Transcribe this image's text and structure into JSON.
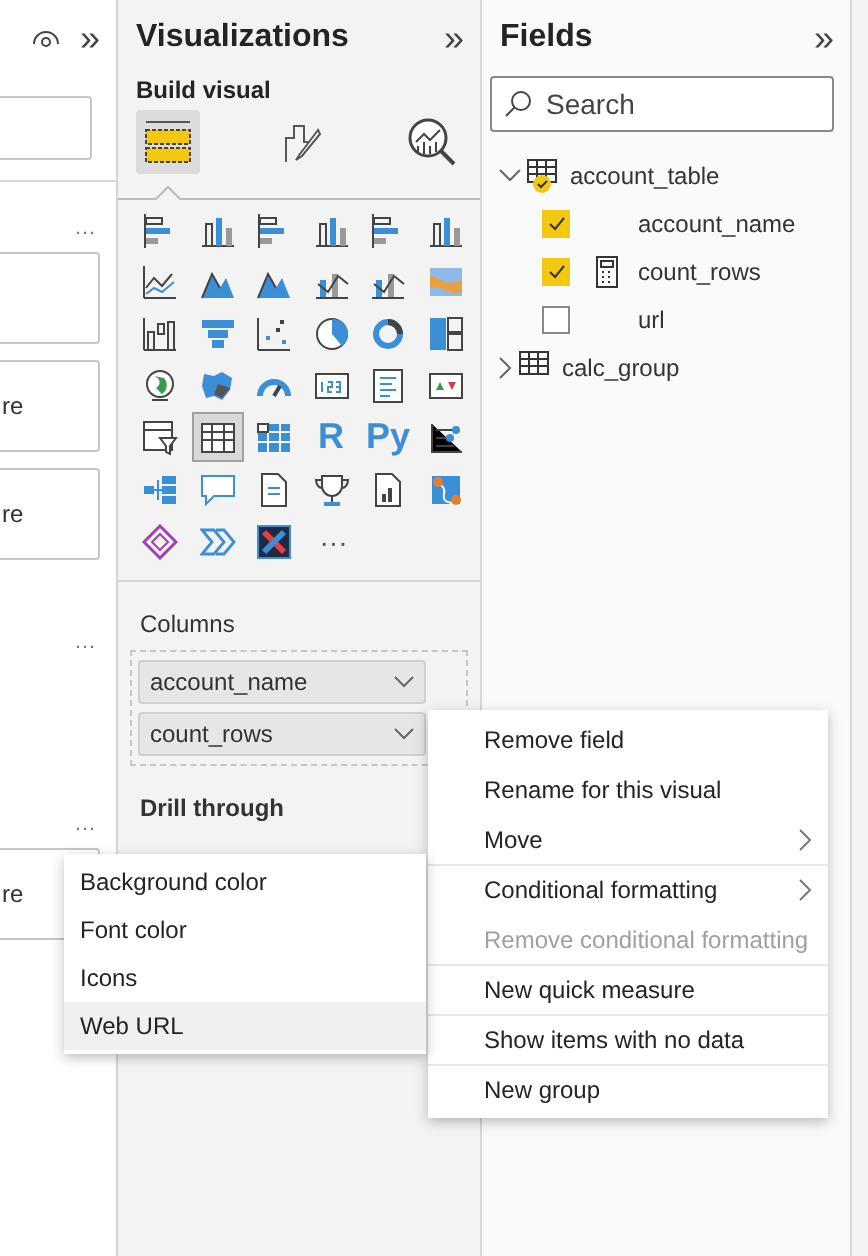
{
  "filters_pane": {
    "collapse": "»",
    "boxes": [
      {
        "kind": "field"
      },
      {
        "kind": "card"
      },
      {
        "kind": "card",
        "text": "re"
      },
      {
        "kind": "card",
        "text": "re"
      },
      {
        "kind": "card",
        "text": "re"
      }
    ],
    "more": [
      "…",
      "…",
      "…"
    ]
  },
  "visualizations": {
    "title": "Visualizations",
    "collapse": "»",
    "subtitle": "Build visual",
    "modes": [
      {
        "selected": true
      },
      {
        "selected": false
      },
      {
        "selected": false
      }
    ],
    "gallery": [
      {
        "selected": false
      },
      {
        "selected": false
      },
      {
        "selected": false
      },
      {
        "selected": false
      },
      {
        "selected": false
      },
      {
        "selected": false
      },
      {
        "selected": false
      },
      {
        "selected": false
      },
      {
        "selected": false
      },
      {
        "selected": false
      },
      {
        "selected": false
      },
      {
        "selected": false
      },
      {
        "selected": false
      },
      {
        "selected": false
      },
      {
        "selected": false
      },
      {
        "selected": false
      },
      {
        "selected": false
      },
      {
        "selected": false
      },
      {
        "selected": false
      },
      {
        "selected": false
      },
      {
        "selected": false
      },
      {
        "selected": false
      },
      {
        "selected": false
      },
      {
        "selected": false
      },
      {
        "selected": false
      },
      {
        "selected": true
      },
      {
        "selected": false
      },
      {
        "label": "R",
        "selected": false
      },
      {
        "label": "Py",
        "selected": false
      },
      {
        "selected": false
      },
      {
        "selected": false
      },
      {
        "selected": false
      },
      {
        "selected": false
      },
      {
        "selected": false
      },
      {
        "selected": false
      },
      {
        "selected": false
      },
      {
        "selected": false
      },
      {
        "selected": false
      },
      {
        "selected": false
      }
    ],
    "gallery_more": "···",
    "wells": [
      {
        "label": "Columns",
        "fields": [
          "account_name",
          "count_rows"
        ]
      }
    ],
    "next_section": "Drill through"
  },
  "fields": {
    "title": "Fields",
    "collapse": "»",
    "search": {
      "placeholder": "Search"
    },
    "tables": [
      {
        "name": "account_table",
        "expanded": true,
        "has_selection": true,
        "children": [
          {
            "name": "account_name",
            "checked": true,
            "kind": "column"
          },
          {
            "name": "count_rows",
            "checked": true,
            "kind": "measure"
          },
          {
            "name": "url",
            "checked": false,
            "kind": "column"
          }
        ]
      },
      {
        "name": "calc_group",
        "expanded": false,
        "has_selection": false
      }
    ]
  },
  "context_menu": [
    {
      "label": "Remove field",
      "disabled": false,
      "submenu": false,
      "divider_before": false
    },
    {
      "label": "Rename for this visual",
      "disabled": false,
      "submenu": false,
      "divider_before": false
    },
    {
      "label": "Move",
      "disabled": false,
      "submenu": true,
      "divider_before": false
    },
    {
      "label": "Conditional formatting",
      "disabled": false,
      "submenu": true,
      "divider_before": true
    },
    {
      "label": "Remove conditional formatting",
      "disabled": true,
      "submenu": false,
      "divider_before": false
    },
    {
      "label": "New quick measure",
      "disabled": false,
      "submenu": false,
      "divider_before": true
    },
    {
      "label": "Show items with no data",
      "disabled": false,
      "submenu": false,
      "divider_before": true
    },
    {
      "label": "New group",
      "disabled": false,
      "submenu": false,
      "divider_before": true
    }
  ],
  "submenu": [
    {
      "label": "Background color",
      "selected": false
    },
    {
      "label": "Font color",
      "selected": false
    },
    {
      "label": "Icons",
      "selected": false
    },
    {
      "label": "Web URL",
      "selected": true
    }
  ]
}
